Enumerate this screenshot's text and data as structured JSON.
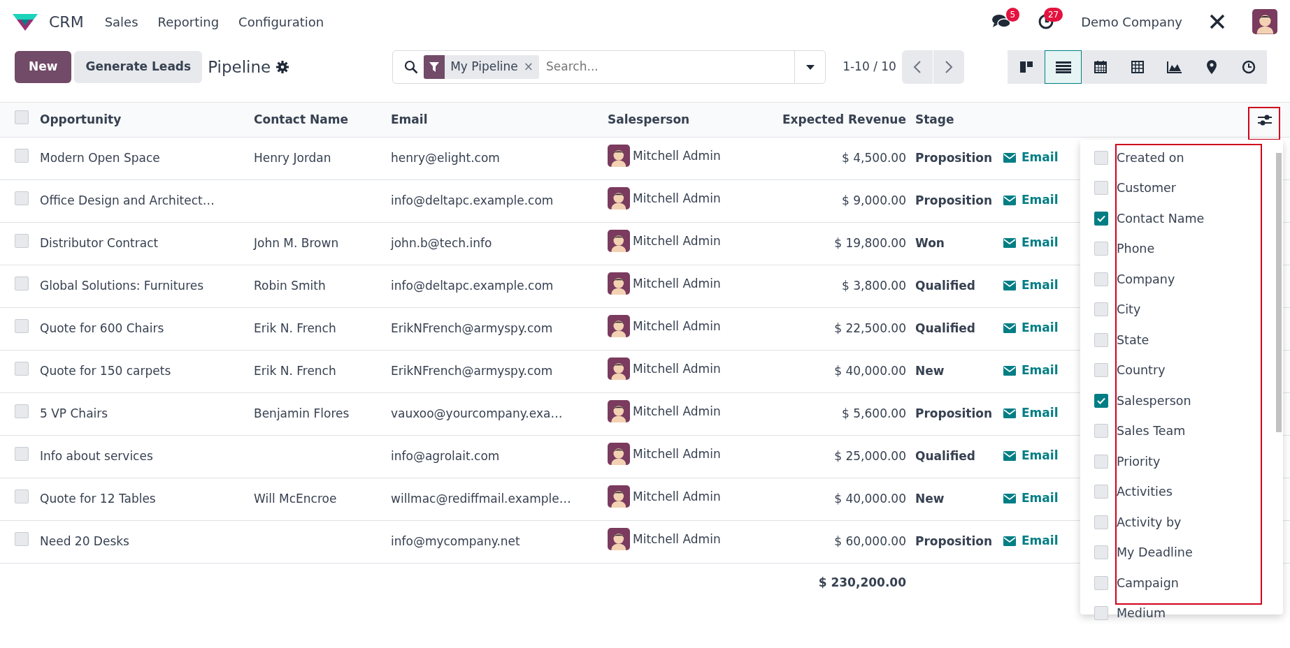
{
  "navbar": {
    "app_name": "CRM",
    "menu": [
      "Sales",
      "Reporting",
      "Configuration"
    ],
    "messages_count": "5",
    "activities_count": "27",
    "company": "Demo Company"
  },
  "control_panel": {
    "new_button": "New",
    "generate_button": "Generate Leads",
    "breadcrumb": "Pipeline",
    "facet": "My Pipeline",
    "facet_remove": "×",
    "search_placeholder": "Search...",
    "pager": "1-10 / 10",
    "views": [
      {
        "kind": "kanban",
        "selected": false
      },
      {
        "kind": "list",
        "selected": true
      },
      {
        "kind": "calendar",
        "selected": false
      },
      {
        "kind": "pivot",
        "selected": false
      },
      {
        "kind": "graph",
        "selected": false
      },
      {
        "kind": "map",
        "selected": false
      },
      {
        "kind": "activity",
        "selected": false
      }
    ]
  },
  "table": {
    "all_checked": false,
    "columns": [
      "Opportunity",
      "Contact Name",
      "Email",
      "Salesperson",
      "Expected Revenue",
      "Stage"
    ],
    "rows": [
      {
        "opportunity": "Modern Open Space",
        "contact": "Henry Jordan",
        "email": "henry@elight.com",
        "salesperson": "Mitchell Admin",
        "revenue": "$ 4,500.00",
        "stage": "Proposition",
        "action": "Email",
        "checked": false
      },
      {
        "opportunity": "Office Design and Architect…",
        "contact": "",
        "email": "info@deltapc.example.com",
        "salesperson": "Mitchell Admin",
        "revenue": "$ 9,000.00",
        "stage": "Proposition",
        "action": "Email",
        "checked": false
      },
      {
        "opportunity": "Distributor Contract",
        "contact": "John M. Brown",
        "email": "john.b@tech.info",
        "salesperson": "Mitchell Admin",
        "revenue": "$ 19,800.00",
        "stage": "Won",
        "action": "Email",
        "checked": false
      },
      {
        "opportunity": "Global Solutions: Furnitures",
        "contact": "Robin Smith",
        "email": "info@deltapc.example.com",
        "salesperson": "Mitchell Admin",
        "revenue": "$ 3,800.00",
        "stage": "Qualified",
        "action": "Email",
        "checked": false
      },
      {
        "opportunity": "Quote for 600 Chairs",
        "contact": "Erik N. French",
        "email": "ErikNFrench@armyspy.com",
        "salesperson": "Mitchell Admin",
        "revenue": "$ 22,500.00",
        "stage": "Qualified",
        "action": "Email",
        "checked": false
      },
      {
        "opportunity": "Quote for 150 carpets",
        "contact": "Erik N. French",
        "email": "ErikNFrench@armyspy.com",
        "salesperson": "Mitchell Admin",
        "revenue": "$ 40,000.00",
        "stage": "New",
        "action": "Email",
        "checked": false
      },
      {
        "opportunity": "5 VP Chairs",
        "contact": "Benjamin Flores",
        "email": "vauxoo@yourcompany.exa…",
        "salesperson": "Mitchell Admin",
        "revenue": "$ 5,600.00",
        "stage": "Proposition",
        "action": "Email",
        "checked": false
      },
      {
        "opportunity": "Info about services",
        "contact": "",
        "email": "info@agrolait.com",
        "salesperson": "Mitchell Admin",
        "revenue": "$ 25,000.00",
        "stage": "Qualified",
        "action": "Email",
        "checked": false
      },
      {
        "opportunity": "Quote for 12 Tables",
        "contact": "Will McEncroe",
        "email": "willmac@rediffmail.example…",
        "salesperson": "Mitchell Admin",
        "revenue": "$ 40,000.00",
        "stage": "New",
        "action": "Email",
        "checked": false
      },
      {
        "opportunity": "Need 20 Desks",
        "contact": "",
        "email": "info@mycompany.net",
        "salesperson": "Mitchell Admin",
        "revenue": "$ 60,000.00",
        "stage": "Proposition",
        "action": "Email",
        "checked": false
      }
    ],
    "total": "$ 230,200.00"
  },
  "optional_columns": [
    {
      "label": "Created on",
      "checked": false
    },
    {
      "label": "Customer",
      "checked": false
    },
    {
      "label": "Contact Name",
      "checked": true
    },
    {
      "label": "Phone",
      "checked": false
    },
    {
      "label": "Company",
      "checked": false
    },
    {
      "label": "City",
      "checked": false
    },
    {
      "label": "State",
      "checked": false
    },
    {
      "label": "Country",
      "checked": false
    },
    {
      "label": "Salesperson",
      "checked": true
    },
    {
      "label": "Sales Team",
      "checked": false
    },
    {
      "label": "Priority",
      "checked": false
    },
    {
      "label": "Activities",
      "checked": false
    },
    {
      "label": "Activity by",
      "checked": false
    },
    {
      "label": "My Deadline",
      "checked": false
    },
    {
      "label": "Campaign",
      "checked": false
    },
    {
      "label": "Medium",
      "checked": false
    }
  ]
}
